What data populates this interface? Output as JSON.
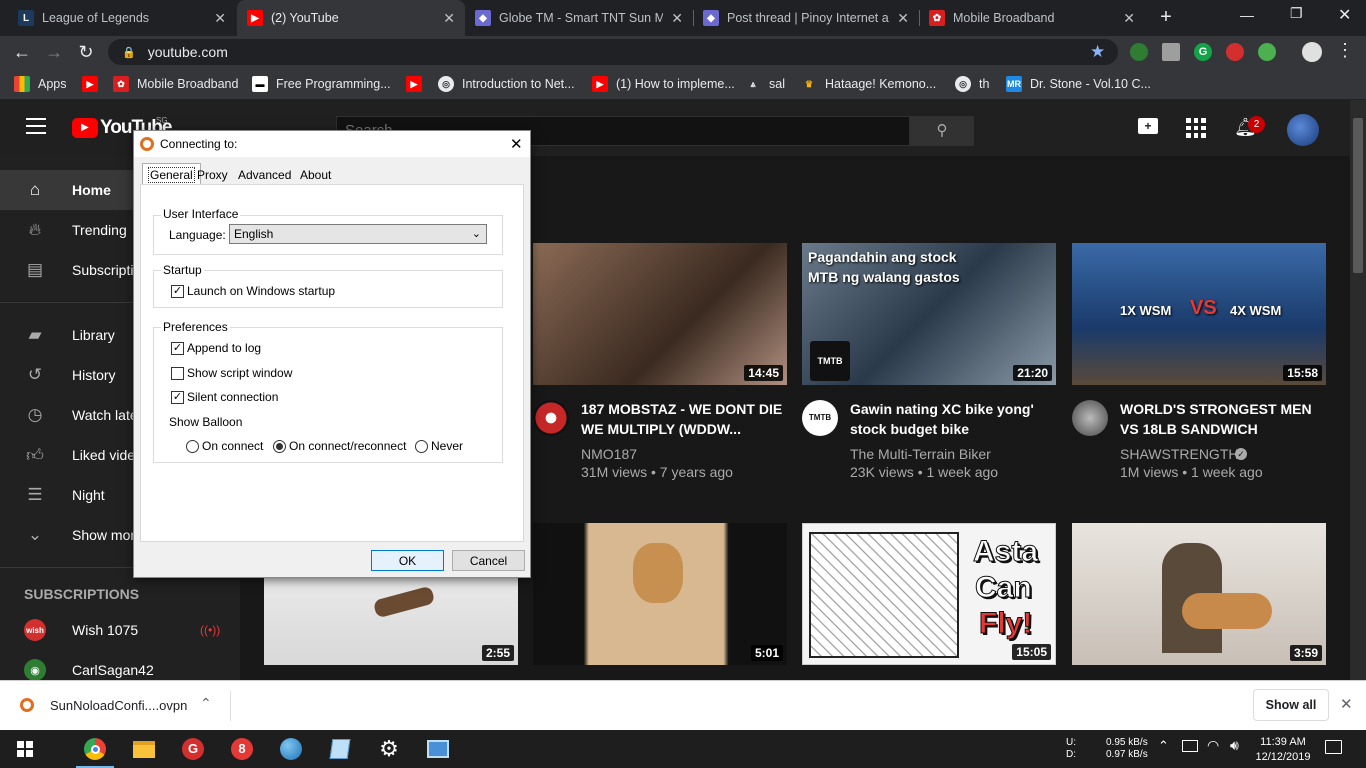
{
  "tabs": [
    {
      "title": "League of Legends",
      "active": false
    },
    {
      "title": "(2) YouTube",
      "active": true
    },
    {
      "title": "Globe TM - Smart TNT Sun Ma",
      "active": false
    },
    {
      "title": "Post thread | Pinoy Internet an",
      "active": false
    },
    {
      "title": "Mobile Broadband",
      "active": false
    }
  ],
  "address": {
    "url": "youtube.com"
  },
  "bookmarks": [
    "Apps",
    "Mobile Broadband",
    "Free Programming...",
    "Introduction to Net...",
    "(1) How to impleme...",
    "sal",
    "Hataage! Kemono...",
    "th",
    "Dr. Stone - Vol.10 C..."
  ],
  "youtube": {
    "logo": "YouTube",
    "region": "SG",
    "search_placeholder": "Search",
    "notification_count": "2",
    "sidebar": [
      {
        "label": "Home",
        "icon": "home-icon",
        "active": true
      },
      {
        "label": "Trending",
        "icon": "fire-icon",
        "active": false
      },
      {
        "label": "Subscriptions",
        "icon": "subscriptions-icon",
        "active": false
      },
      {
        "label": "Library",
        "icon": "library-icon",
        "active": false
      },
      {
        "label": "History",
        "icon": "history-icon",
        "active": false
      },
      {
        "label": "Watch later",
        "icon": "clock-icon",
        "active": false
      },
      {
        "label": "Liked videos",
        "icon": "thumbs-up-icon",
        "active": false
      },
      {
        "label": "Night",
        "icon": "playlist-icon",
        "active": false
      },
      {
        "label": "Show more",
        "icon": "chevron-down-icon",
        "active": false
      }
    ],
    "subscriptions_heading": "SUBSCRIPTIONS",
    "subscriptions": [
      {
        "name": "Wish 1075",
        "live": true
      },
      {
        "name": "CarlSagan42",
        "live": false
      }
    ],
    "videos_row1": [
      {
        "title": "187 MOBSTAZ - WE DONT DIE WE MULTIPLY (WDDW...",
        "channel": "NMO187",
        "meta": "31M views • 7 years ago",
        "duration": "14:45",
        "thumb_color": "#6b5446"
      },
      {
        "title": "Gawin nating XC bike yong' stock budget bike",
        "channel": "The Multi-Terrain Biker",
        "meta": "23K views • 1 week ago",
        "duration": "21:20",
        "thumb_color": "#4a5a6a",
        "overlay": "Pagandahin ang stock MTB ng walang gastos"
      },
      {
        "title": "WORLD'S STRONGEST MEN VS 18LB SANDWICH",
        "channel": "SHAWSTRENGTH",
        "meta": "1M views • 1 week ago",
        "duration": "15:58",
        "thumb_color": "#2a4a7a",
        "overlay_left": "1X WSM",
        "overlay_vs": "VS",
        "overlay_right": "4X WSM"
      }
    ],
    "videos_row2": [
      {
        "duration": "2:55",
        "thumb_color": "#e8e8e8"
      },
      {
        "duration": "5:01",
        "thumb_color": "#c8a070"
      },
      {
        "duration": "15:05",
        "thumb_color": "#f0f0f0",
        "overlay": [
          "Asta",
          "Can",
          "Fly!"
        ]
      },
      {
        "duration": "3:59",
        "thumb_color": "#d8d0c8"
      }
    ]
  },
  "dialog": {
    "title": "Connecting to:",
    "tabs": [
      "General",
      "Proxy",
      "Advanced",
      "About"
    ],
    "ui_group": "User Interface",
    "language_label": "Language:",
    "language_value": "English",
    "startup_group": "Startup",
    "launch_on_startup": {
      "label": "Launch on Windows startup",
      "checked": true
    },
    "preferences_group": "Preferences",
    "append_to_log": {
      "label": "Append to log",
      "checked": true
    },
    "show_script_window": {
      "label": "Show script window",
      "checked": false
    },
    "silent_connection": {
      "label": "Silent connection",
      "checked": true
    },
    "show_balloon_label": "Show Balloon",
    "balloon_options": [
      {
        "label": "On connect",
        "selected": false
      },
      {
        "label": "On connect/reconnect",
        "selected": true
      },
      {
        "label": "Never",
        "selected": false
      }
    ],
    "ok": "OK",
    "cancel": "Cancel"
  },
  "download": {
    "filename": "SunNoloadConfi....ovpn",
    "show_all": "Show all"
  },
  "taskbar": {
    "net_up_label": "U:",
    "net_down_label": "D:",
    "net_up": "0.95 kB/s",
    "net_down": "0.97 kB/s",
    "time": "11:39 AM",
    "date": "12/12/2019"
  }
}
